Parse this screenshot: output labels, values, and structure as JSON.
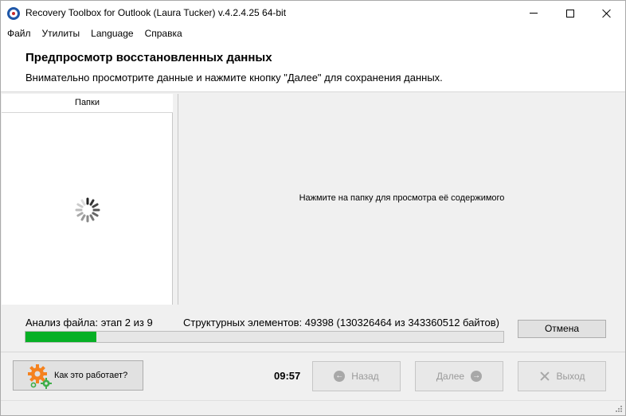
{
  "window": {
    "title": "Recovery Toolbox for Outlook (Laura Tucker) v.4.2.4.25 64-bit"
  },
  "menu": {
    "items": [
      "Файл",
      "Утилиты",
      "Language",
      "Справка"
    ]
  },
  "header": {
    "title": "Предпросмотр восстановленных данных",
    "subtitle": "Внимательно просмотрите данные и нажмите кнопку \"Далее\" для сохранения данных."
  },
  "left_pane": {
    "header": "Папки"
  },
  "right_pane": {
    "message": "Нажмите на папку для просмотра её содержимого"
  },
  "status": {
    "analysis": "Анализ файла: этап 2 из 9",
    "elements": "Структурных элементов: 49398 (130326464 из 343360512 байтов)",
    "progress": 0.148
  },
  "buttons": {
    "cancel": "Отмена",
    "how_it_works": "Как это работает?",
    "back": "Назад",
    "next": "Далее",
    "exit": "Выход"
  },
  "timer": "09:57",
  "colors": {
    "progress": "#06b025",
    "gear_orange": "#f5821f",
    "gear_green": "#3fae49"
  }
}
